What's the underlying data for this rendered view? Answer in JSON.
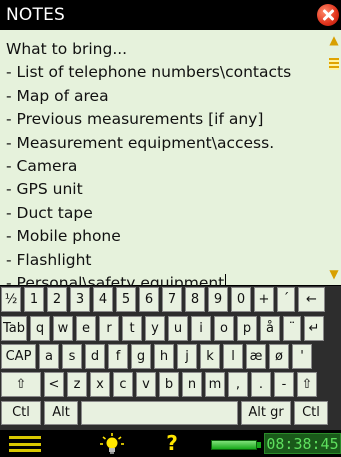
{
  "window": {
    "title": "NOTES"
  },
  "notes": {
    "lines": [
      "What to bring...",
      "- List of  telephone numbers\\contacts",
      "- Map of area",
      "- Previous measurements [if any]",
      "- Measurement equipment\\access.",
      "- Camera",
      "- GPS unit",
      "- Duct tape",
      "- Mobile phone",
      "- Flashlight",
      "- Personal\\safety equipment"
    ]
  },
  "keyboard": {
    "row1": [
      "½",
      "1",
      "2",
      "3",
      "4",
      "5",
      "6",
      "7",
      "8",
      "9",
      "0",
      "+",
      "´",
      "←"
    ],
    "row2": [
      "Tab",
      "q",
      "w",
      "e",
      "r",
      "t",
      "y",
      "u",
      "i",
      "o",
      "p",
      "å",
      "¨",
      "↵"
    ],
    "row3": [
      "CAP",
      "a",
      "s",
      "d",
      "f",
      "g",
      "h",
      "j",
      "k",
      "l",
      "æ",
      "ø",
      "'"
    ],
    "row4": [
      "⇧",
      "<",
      "z",
      "x",
      "c",
      "v",
      "b",
      "n",
      "m",
      ",",
      ".",
      "-",
      "⇧"
    ],
    "row5": [
      "Ctl",
      "Alt",
      "",
      "Alt gr",
      "Ctl"
    ]
  },
  "status": {
    "clock": "08:38:45",
    "help_label": "?",
    "icons": [
      "menu-icon",
      "light-bulb-icon",
      "help-icon",
      "battery-icon"
    ],
    "colors": {
      "accent": "#ffe600",
      "clock_text": "#5ee05e",
      "notes_bg": "#e6f2dc"
    }
  }
}
